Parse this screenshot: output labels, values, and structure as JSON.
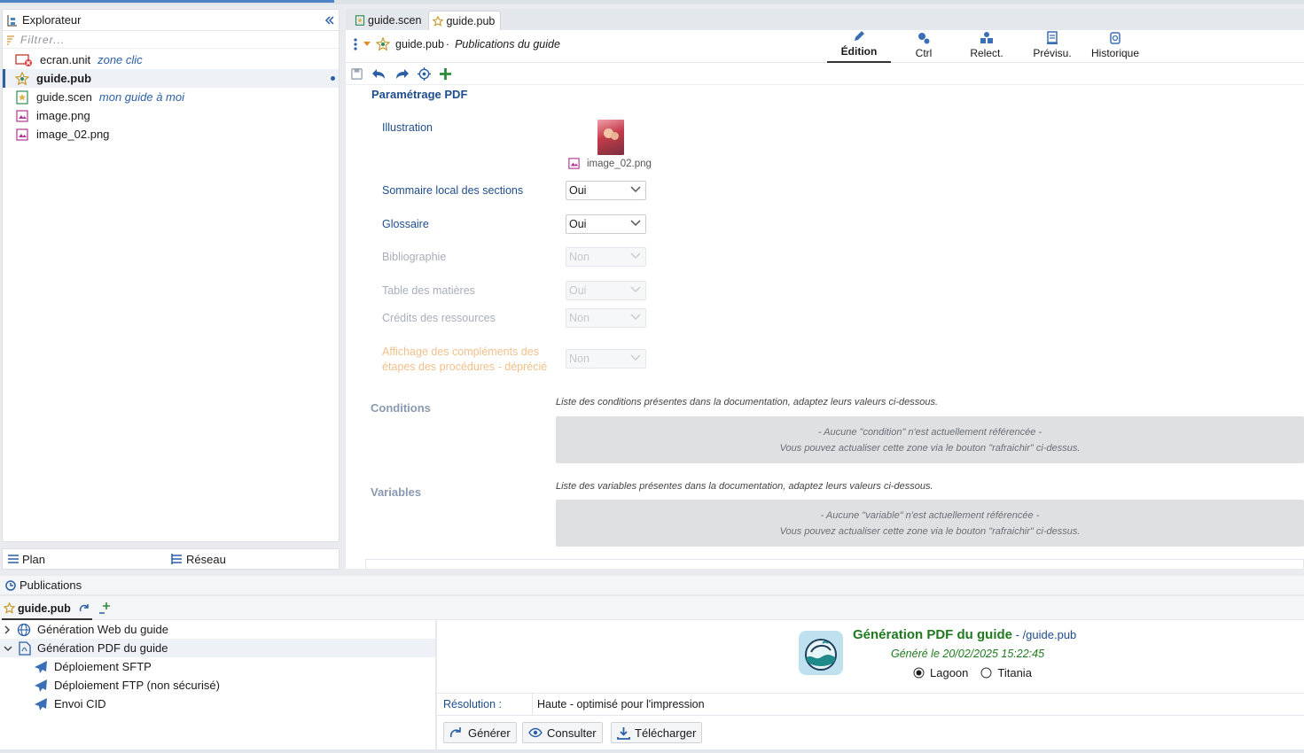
{
  "explorer": {
    "title": "Explorateur",
    "filter_placeholder": "Filtrer...",
    "items": [
      {
        "name": "ecran.unit",
        "subtitle": "zone clic"
      },
      {
        "name": "guide.pub",
        "subtitle": ""
      },
      {
        "name": "guide.scen",
        "subtitle": "mon guide à moi"
      },
      {
        "name": "image.png",
        "subtitle": ""
      },
      {
        "name": "image_02.png",
        "subtitle": ""
      }
    ],
    "bottom_tabs": [
      "Plan",
      "Réseau"
    ]
  },
  "editor": {
    "tabs": [
      "guide.scen",
      "guide.pub"
    ],
    "doc_name": "guide.pub",
    "doc_subtitle": "Publications du guide",
    "view_tabs": [
      "Édition",
      "Ctrl",
      "Relect.",
      "Prévisu.",
      "Historique"
    ],
    "section_title": "Paramétrage PDF",
    "illustration_label": "Illustration",
    "illustration_file": "image_02.png",
    "fields": [
      {
        "label": "Sommaire local des sections",
        "value": "Oui"
      },
      {
        "label": "Glossaire",
        "value": "Oui"
      },
      {
        "label": "Bibliographie",
        "value": "Non"
      },
      {
        "label": "Table des matières",
        "value": "Oui"
      },
      {
        "label": "Crédits des ressources",
        "value": "Non"
      },
      {
        "label_line1": "Affichage des compléments des",
        "label_line2": "étapes des procédures - déprécié",
        "value": "Non"
      }
    ],
    "conditions": {
      "title": "Conditions",
      "description": "Liste des conditions présentes dans la documentation, adaptez leurs valeurs ci-dessous.",
      "empty_line1": "- Aucune \"condition\" n'est actuellement référencée -",
      "empty_line2": "Vous pouvez actualiser cette zone via le bouton \"rafraichir\" ci-dessus."
    },
    "variables": {
      "title": "Variables",
      "description": "Liste des variables présentes dans la documentation, adaptez leurs valeurs ci-dessous.",
      "empty_line1": "- Aucune \"variable\" n'est actuellement référencée -",
      "empty_line2": "Vous pouvez actualiser cette zone via le bouton \"rafraichir\" ci-dessus."
    }
  },
  "publications": {
    "title": "Publications",
    "tab": "guide.pub",
    "tree": [
      {
        "label": "Génération Web du guide"
      },
      {
        "label": "Génération PDF du guide"
      },
      {
        "label": "Déploiement SFTP"
      },
      {
        "label": "Déploiement FTP (non sécurisé)"
      },
      {
        "label": "Envoi CID"
      }
    ],
    "detail": {
      "title": "Génération PDF du guide",
      "path": " - /guide.pub",
      "generated": "Généré le 20/02/2025 15:22:45",
      "skins": [
        "Lagoon",
        "Titania"
      ],
      "resolution_label": "Résolution :",
      "resolution_value": "Haute - optimisé pour l'impression",
      "buttons": [
        "Générer",
        "Consulter",
        "Télécharger"
      ]
    }
  },
  "colors": {
    "accent_blue": "#2a5fa5",
    "pdf_title_green": "#1f7a1f",
    "disabled_text": "#a6aeb9",
    "deprecated_text": "#f1c08a"
  }
}
